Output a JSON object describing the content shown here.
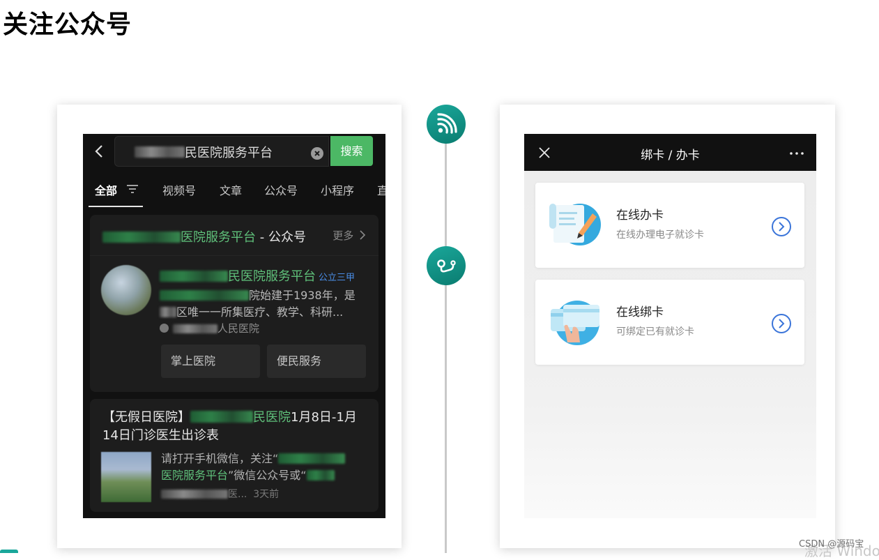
{
  "page": {
    "title": "关注公众号"
  },
  "search_screen": {
    "search_text": "民医院服务平台",
    "search_button": "搜索",
    "tabs": [
      "全部",
      "视频号",
      "文章",
      "公众号",
      "小程序",
      "直"
    ],
    "section_title_green": "医院服务平台",
    "section_title_rest": " - 公众号",
    "more": "更多",
    "account": {
      "name": "民医院服务平台",
      "badge": "公立三甲",
      "desc_line1": "院始建于1938年，是",
      "desc_line2": "区唯一一所集医疗、教学、科研...",
      "verified_by": "人民医院",
      "services": [
        "掌上医院",
        "便民服务"
      ]
    },
    "article": {
      "title_prefix": "【无假日医院】",
      "title_green": "民医院",
      "title_suffix": "1月8日-1月14日门诊医生出诊表",
      "desc_line1": "请打开手机微信，关注“",
      "desc_green": "医院服务平台",
      "desc_line2_rest": "”微信公众号或“",
      "meta_snippet": "医...",
      "meta_time": "3天前"
    }
  },
  "card_screen": {
    "nav_title": "绑卡 / 办卡",
    "options": [
      {
        "title": "在线办卡",
        "subtitle": "在线办理电子就诊卡"
      },
      {
        "title": "在线绑卡",
        "subtitle": "可绑定已有就诊卡"
      }
    ]
  },
  "icons": {
    "back": "chevron-left-icon",
    "clear": "clear-circle-icon",
    "filter": "filter-icon",
    "timeline_1": "rss-feed-icon",
    "timeline_2": "route-icon",
    "close": "close-x-icon",
    "more": "more-dots-icon",
    "arrow": "chevron-right-circle-icon"
  },
  "colors": {
    "accent_green": "#4cb865",
    "timeline_teal": "#0f8d80",
    "link_blue": "#3a74d9"
  },
  "watermark": {
    "csdn": "CSDN @源码宝",
    "windows": "激活 Windo"
  }
}
